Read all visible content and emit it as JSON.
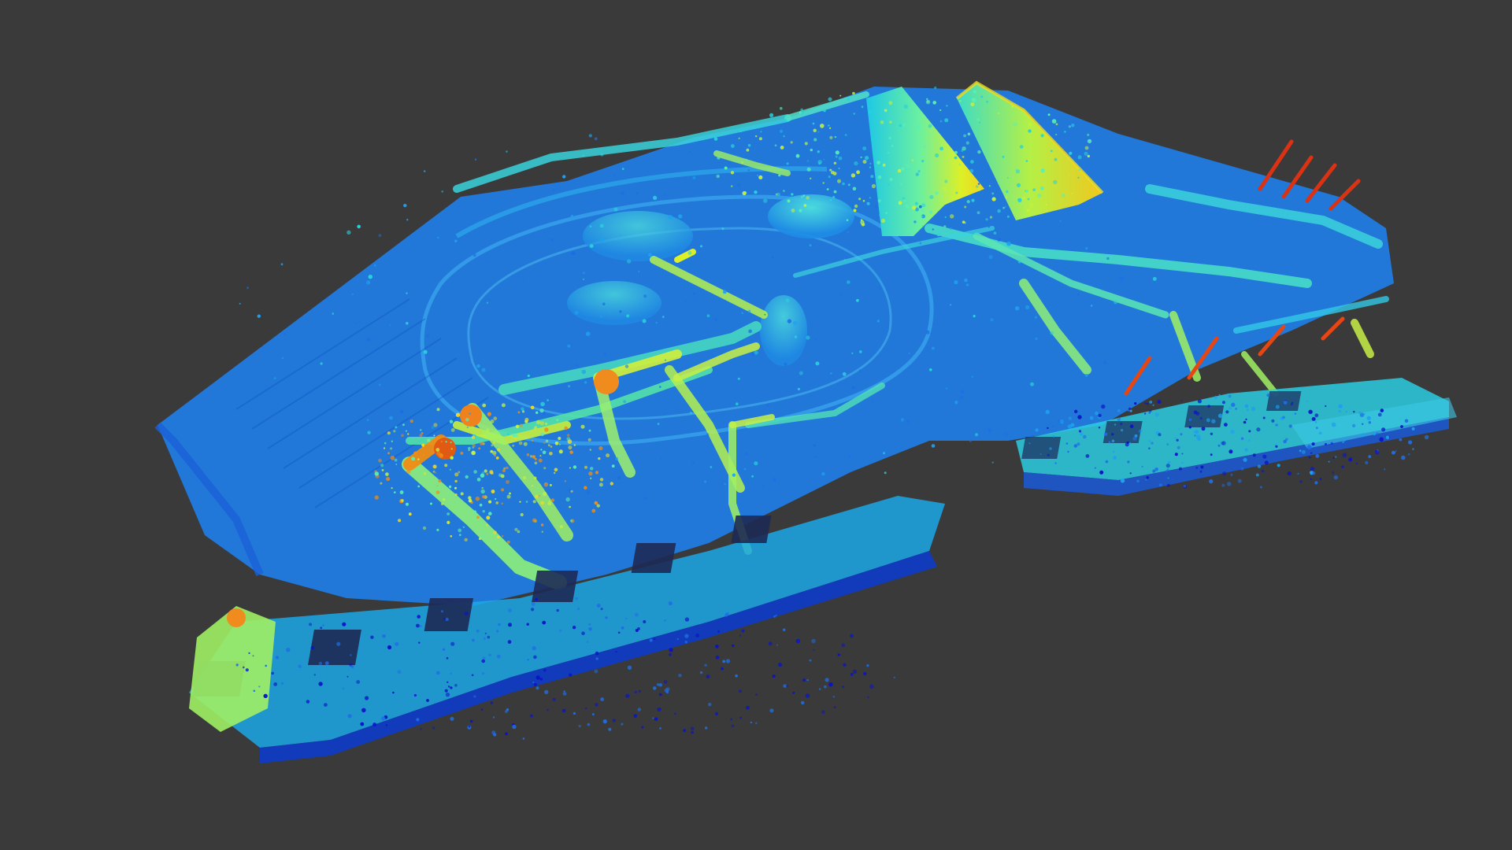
{
  "viewer": {
    "background_color": "#3a3a3a",
    "colormap": "jet",
    "colormap_stops": [
      "#0a14c8",
      "#1e6ee6",
      "#1ea0f0",
      "#28d2dc",
      "#5af0b4",
      "#c8f03c",
      "#f0dc1e",
      "#f08c14",
      "#dc2814"
    ],
    "scene": "point-cloud-port-terminal"
  },
  "scene": {
    "objects": [
      {
        "name": "terminal-platform",
        "color_band": "blue"
      },
      {
        "name": "storage-sheds",
        "color_band": "cyan-yellow",
        "count": 2
      },
      {
        "name": "stockpile-mounds",
        "color_band": "cyan",
        "count": 3
      },
      {
        "name": "ship-loader-cranes",
        "color_band": "green-orange"
      },
      {
        "name": "bulk-carrier-front",
        "color_band": "cyan"
      },
      {
        "name": "bulk-carrier-rear",
        "color_band": "cyan"
      },
      {
        "name": "conveyor-belts",
        "color_band": "cyan-green"
      },
      {
        "name": "light-poles",
        "color_band": "red"
      }
    ]
  }
}
